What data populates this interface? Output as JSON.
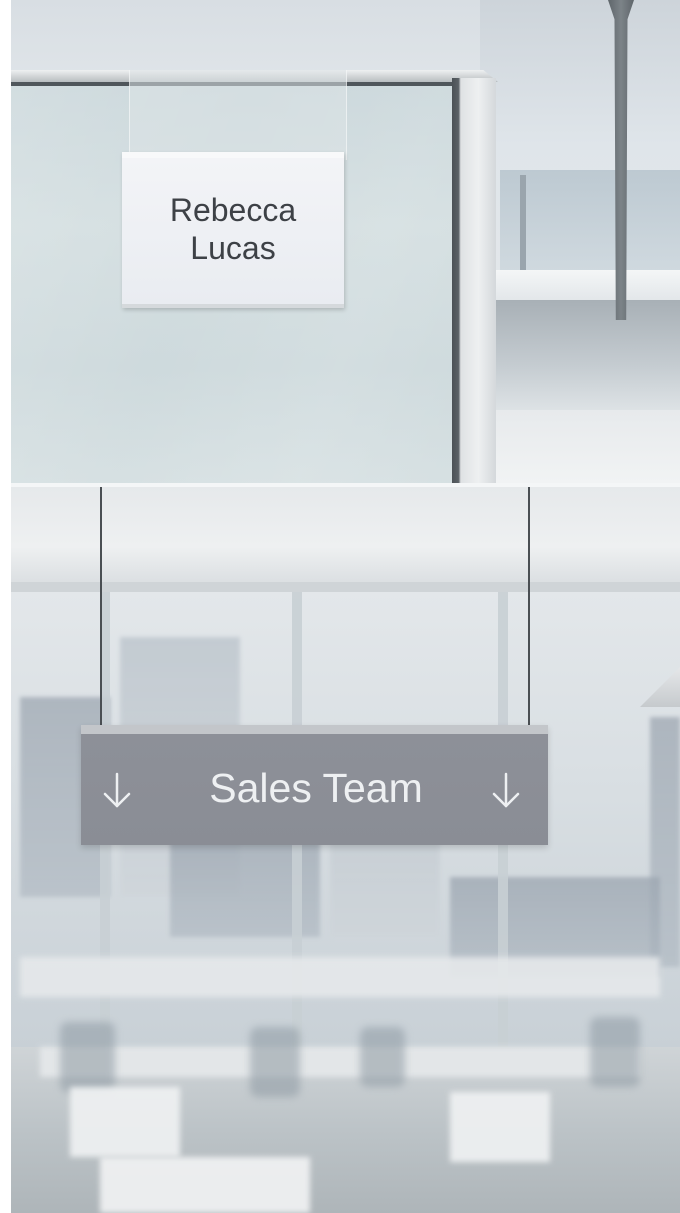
{
  "name_plate": {
    "first_name": "Rebecca",
    "last_name": "Lucas"
  },
  "hanging_sign": {
    "label": "Sales Team",
    "left_icon": "arrow-down-icon",
    "right_icon": "arrow-down-icon"
  },
  "colors": {
    "name_plate_text": "#3d4146",
    "sign_background": "#8d9098",
    "sign_text": "#eef0f2"
  }
}
